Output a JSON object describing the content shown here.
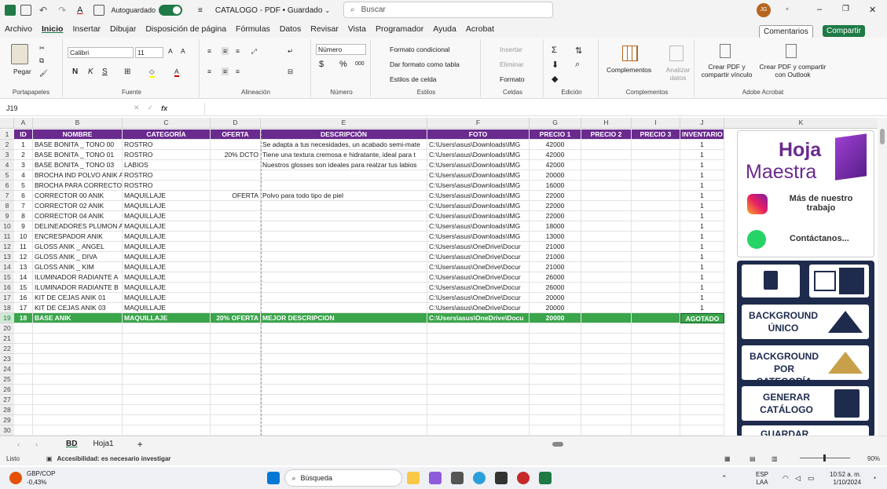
{
  "titlebar": {
    "autosave": "Autoguardado",
    "doc_title": "CATALOGO - PDF • Guardado",
    "search_placeholder": "Buscar",
    "user_initials": "JG"
  },
  "menu": {
    "tabs": [
      "Archivo",
      "Inicio",
      "Insertar",
      "Dibujar",
      "Disposición de página",
      "Fórmulas",
      "Datos",
      "Revisar",
      "Vista",
      "Programador",
      "Ayuda",
      "Acrobat"
    ],
    "comments": "Comentarios",
    "share": "Compartir"
  },
  "ribbon": {
    "clipboard": {
      "paste": "Pegar",
      "label": "Portapapeles"
    },
    "font": {
      "name": "Calibri",
      "size": "11",
      "label": "Fuente",
      "bold": "N",
      "italic": "K",
      "underline": "S"
    },
    "alignment": {
      "label": "Alineación"
    },
    "number": {
      "format": "Número",
      "label": "Número",
      "currency": "$",
      "percent": "%",
      "thousands": "000"
    },
    "styles": {
      "conditional": "Formato condicional",
      "table": "Dar formato como tabla",
      "cell_styles": "Estilos de celda",
      "label": "Estilos"
    },
    "cells": {
      "insert": "Insertar",
      "delete": "Eliminar",
      "format": "Formato",
      "label": "Celdas"
    },
    "editing": {
      "label": "Edición"
    },
    "addins": {
      "complements": "Complementos",
      "analyze": "Analizar datos",
      "label": "Complementos"
    },
    "acrobat": {
      "pdf_link": "Crear PDF y compartir vínculo",
      "pdf_outlook": "Crear PDF y compartir con Outlook",
      "label": "Adobe Acrobat"
    }
  },
  "formula_bar": {
    "cell": "J19",
    "fx": "fx"
  },
  "columns": [
    "A",
    "B",
    "C",
    "D",
    "E",
    "F",
    "G",
    "H",
    "I",
    "J"
  ],
  "headers": [
    "ID",
    "NOMBRE",
    "CATEGORÍA",
    "OFERTA",
    "DESCRIPCIÓN",
    "FOTO",
    "PRECIO 1",
    "PRECIO 2",
    "PRECIO 3",
    "INVENTARIO"
  ],
  "rows": [
    [
      "1",
      "BASE BONITA _ TONO 00",
      "ROSTRO",
      "",
      "Se adapta a tus necesidades, un acabado semi-mate",
      "C:\\Users\\asus\\Downloads\\IMG",
      "42000",
      "",
      "",
      "1"
    ],
    [
      "2",
      "BASE BONITA _ TONO 01",
      "ROSTRO",
      "20% DCTO",
      "Tiene una textura cremosa e hidratante, ideal para t",
      "C:\\Users\\asus\\Downloads\\IMG",
      "42000",
      "",
      "",
      "1"
    ],
    [
      "3",
      "BASE BONITA _ TONO 03",
      "LABIOS",
      "",
      "Nuestros glosses son ideales para realzar tus labios",
      "C:\\Users\\asus\\Downloads\\IMG",
      "42000",
      "",
      "",
      "1"
    ],
    [
      "4",
      "BROCHA IND POLVO ANIK A",
      "ROSTRO",
      "",
      "",
      "C:\\Users\\asus\\Downloads\\IMG",
      "20000",
      "",
      "",
      "1"
    ],
    [
      "5",
      "BROCHA PARA CORRECTOR",
      "ROSTRO",
      "",
      "",
      "C:\\Users\\asus\\Downloads\\IMG",
      "16000",
      "",
      "",
      "1"
    ],
    [
      "6",
      "CORRECTOR 00 ANIK",
      "MAQUILLAJE",
      "OFERTA",
      "Polvo para todo tipo de piel",
      "C:\\Users\\asus\\Downloads\\IMG",
      "22000",
      "",
      "",
      "1"
    ],
    [
      "7",
      "CORRECTOR 02 ANIK",
      "MAQUILLAJE",
      "",
      "",
      "C:\\Users\\asus\\Downloads\\IMG",
      "22000",
      "",
      "",
      "1"
    ],
    [
      "8",
      "CORRECTOR 04 ANIK",
      "MAQUILLAJE",
      "",
      "",
      "C:\\Users\\asus\\Downloads\\IMG",
      "22000",
      "",
      "",
      "1"
    ],
    [
      "9",
      "DELINEADORES PLUMON AN",
      "MAQUILLAJE",
      "",
      "",
      "C:\\Users\\asus\\Downloads\\IMG",
      "18000",
      "",
      "",
      "1"
    ],
    [
      "10",
      "ENCRESPADOR ANIK",
      "MAQUILLAJE",
      "",
      "",
      "C:\\Users\\asus\\Downloads\\IMG",
      "13000",
      "",
      "",
      "1"
    ],
    [
      "11",
      "GLOSS ANIK _ ANGEL",
      "MAQUILLAJE",
      "",
      "",
      "C:\\Users\\asus\\OneDrive\\Docur",
      "21000",
      "",
      "",
      "1"
    ],
    [
      "12",
      "GLOSS ANIK _ DIVA",
      "MAQUILLAJE",
      "",
      "",
      "C:\\Users\\asus\\OneDrive\\Docur",
      "21000",
      "",
      "",
      "1"
    ],
    [
      "13",
      "GLOSS ANIK _ KIM",
      "MAQUILLAJE",
      "",
      "",
      "C:\\Users\\asus\\OneDrive\\Docur",
      "21000",
      "",
      "",
      "1"
    ],
    [
      "14",
      "ILUMINADOR RADIANTE A",
      "MAQUILLAJE",
      "",
      "",
      "C:\\Users\\asus\\OneDrive\\Docur",
      "26000",
      "",
      "",
      "1"
    ],
    [
      "15",
      "ILUMINADOR RADIANTE B",
      "MAQUILLAJE",
      "",
      "",
      "C:\\Users\\asus\\OneDrive\\Docur",
      "26000",
      "",
      "",
      "1"
    ],
    [
      "16",
      "KIT DE CEJAS ANIK 01",
      "MAQUILLAJE",
      "",
      "",
      "C:\\Users\\asus\\OneDrive\\Docur",
      "20000",
      "",
      "",
      "1"
    ],
    [
      "17",
      "KIT DE CEJAS ANIK 03",
      "MAQUILLAJE",
      "",
      "",
      "C:\\Users\\asus\\OneDrive\\Docur",
      "20000",
      "",
      "",
      "1"
    ],
    [
      "18",
      "BASE ANIK",
      "MAQUILLAJE",
      "20% OFERTA",
      "MEJOR DESCRIPCION",
      "C:\\Users\\asus\\OneDrive\\Docu",
      "20000",
      "",
      "",
      "AGOTADO"
    ]
  ],
  "empty_rows": [
    "20",
    "21",
    "22",
    "23",
    "24",
    "25",
    "26",
    "27",
    "28",
    "29",
    "30"
  ],
  "panel": {
    "col": "K",
    "logo_top": "Hoja",
    "logo_bottom": "Maestra",
    "more_work": "Más de nuestro trabajo",
    "contact": "Contáctanos...",
    "btn_bg_unique": "BACKGROUND ÚNICO",
    "btn_bg_category": "BACKGROUND POR CATEGORÍA",
    "btn_generate": "GENERAR CATÁLOGO",
    "btn_save": "GUARDAR"
  },
  "sheets": {
    "tabs": [
      "BD",
      "Hoja1"
    ],
    "add": "+"
  },
  "status": {
    "ready": "Listo",
    "accessibility": "Accesibilidad: es necesario investigar",
    "zoom": "90%"
  },
  "taskbar": {
    "ticker": "GBP/COP",
    "change": "-0,43%",
    "search": "Búsqueda",
    "lang": "ESP",
    "lang2": "LAA",
    "time": "10:52 a. m.",
    "date": "1/10/2024"
  },
  "colors": {
    "header": "#6a2a8e",
    "selected_row": "#3aa54b",
    "nav_bg": "#1e2b4d",
    "accent": "#1f7a45"
  }
}
